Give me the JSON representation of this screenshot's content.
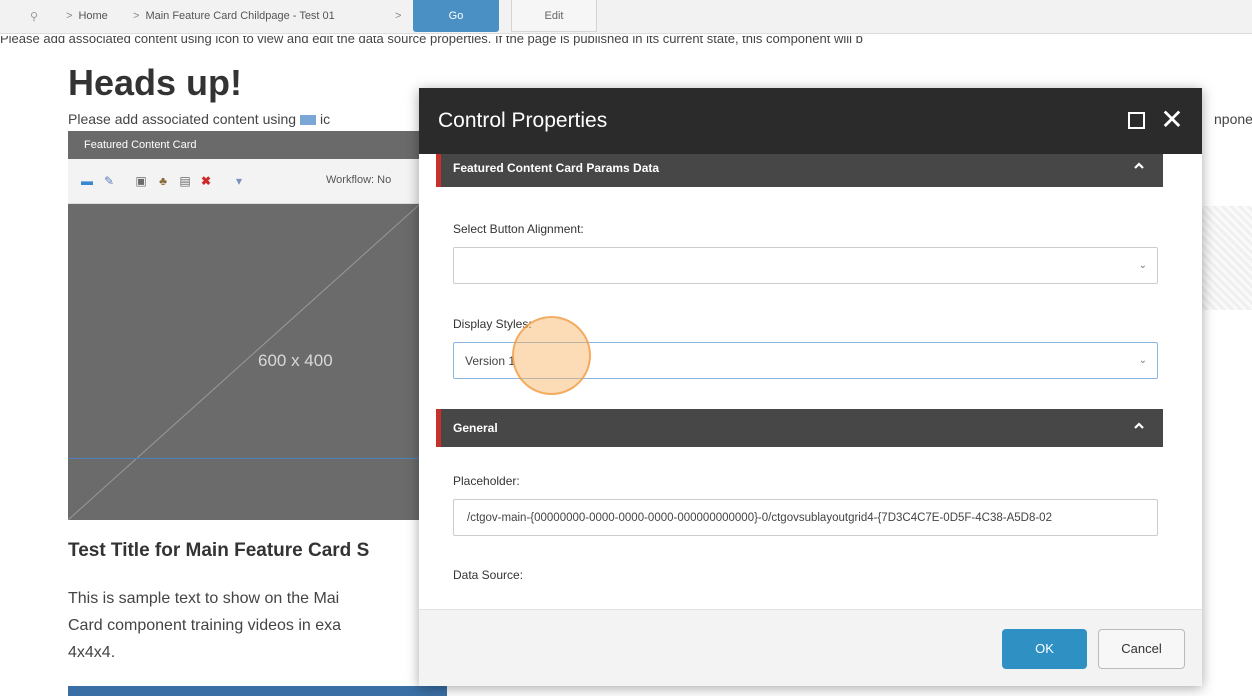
{
  "breadcrumb": {
    "items": [
      "Home",
      "Main Feature Card Childpage - Test 01"
    ],
    "go_label": "Go",
    "edit_label": "Edit"
  },
  "page": {
    "cut_text": "Please add associated content using icon to view and edit the data source properties. If the page is published in its current state, this component will b",
    "heading": "Heads up!",
    "notice_text": "Please add associated content using",
    "notice_suffix": "ic",
    "notice_right": "nponer"
  },
  "featured_card": {
    "header": "Featured Content Card",
    "workflow": "Workflow: No",
    "image_placeholder": "600 x 400",
    "title": "Test Title for Main Feature Card S",
    "body_lines": [
      "This is sample text to show on the Mai",
      "Card component training videos in exa",
      "4x4x4."
    ]
  },
  "modal": {
    "title": "Control Properties",
    "section_params": "Featured Content Card Params Data",
    "button_alignment_label": "Select Button Alignment:",
    "button_alignment_value": "",
    "display_styles_label": "Display Styles:",
    "display_styles_value": "Version 1",
    "section_general": "General",
    "placeholder_label": "Placeholder:",
    "placeholder_value": "/ctgov-main-{00000000-0000-0000-0000-000000000000}-0/ctgovsublayoutgrid4-{7D3C4C7E-0D5F-4C38-A5D8-02",
    "data_source_label": "Data Source:",
    "ok_label": "OK",
    "cancel_label": "Cancel"
  },
  "colors": {
    "accent_blue": "#2f90c4",
    "section_red": "#c9302c",
    "header_dark": "#2b2b2b"
  }
}
